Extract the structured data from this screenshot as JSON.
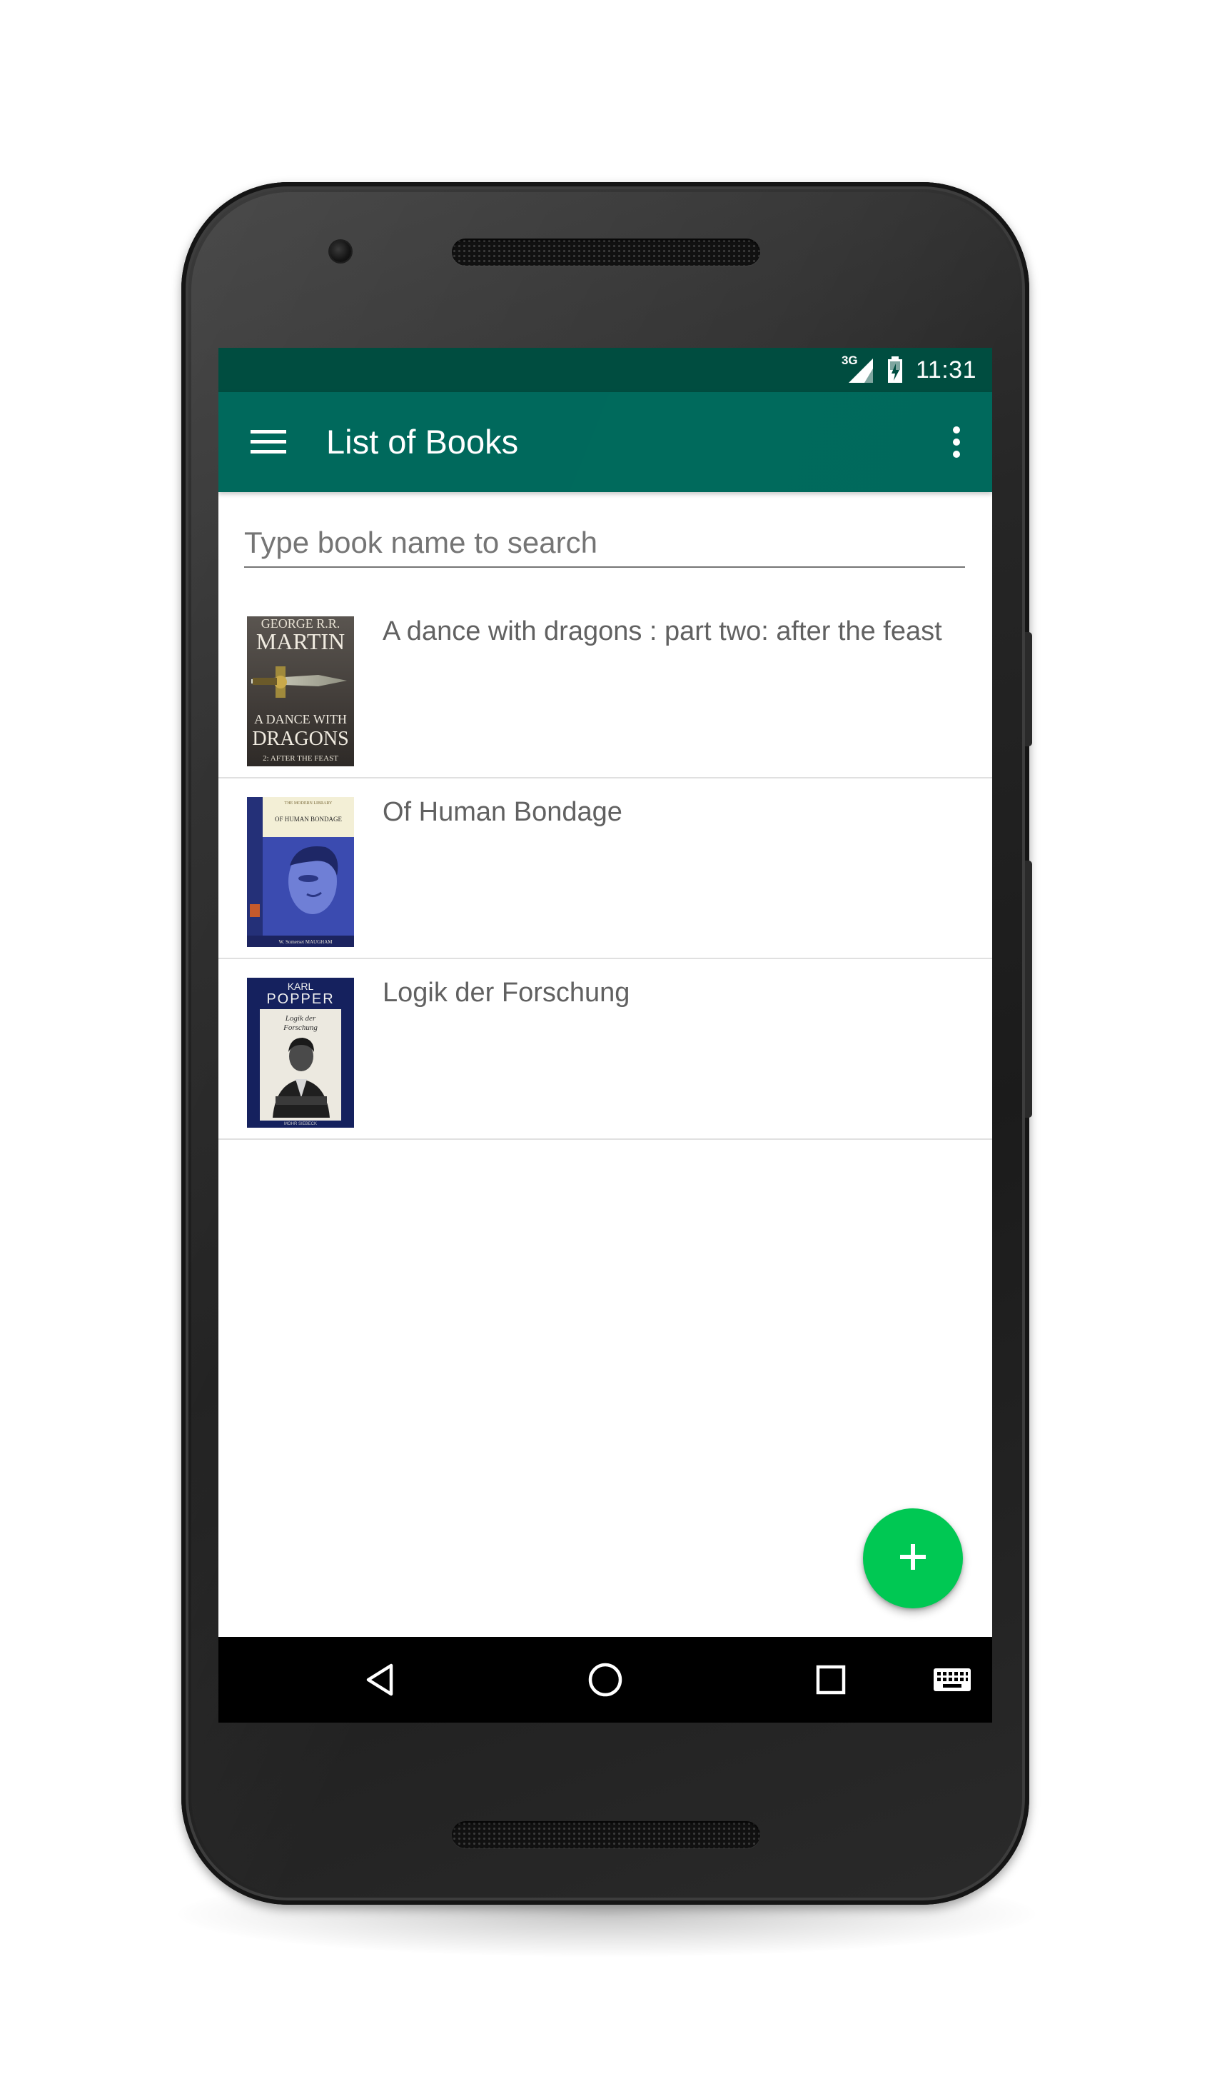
{
  "status_bar": {
    "network_type": "3G",
    "time": "11:31"
  },
  "toolbar": {
    "title": "List of Books",
    "menu_icon": "hamburger-menu-icon",
    "overflow_icon": "more-vert-icon"
  },
  "search": {
    "placeholder": "Type book name to search",
    "value": ""
  },
  "books": [
    {
      "title": "A dance with dragons : part two: after the feast",
      "cover": {
        "author_line1": "GEORGE R.R.",
        "author_line2": "MARTIN",
        "title_line1": "A DANCE WITH",
        "title_line2": "DRAGONS",
        "subtitle": "2: AFTER THE FEAST"
      }
    },
    {
      "title": "Of Human Bondage",
      "cover": {
        "series": "THE MODERN LIBRARY",
        "title": "OF HUMAN BONDAGE",
        "author": "W. Somerset MAUGHAM"
      }
    },
    {
      "title": "Logik der Forschung",
      "cover": {
        "author_line1": "KARL",
        "author_line2": "POPPER",
        "title_line1": "Logik der",
        "title_line2": "Forschung",
        "footer": "MOHR SIEBECK"
      }
    }
  ],
  "fab": {
    "icon": "plus-icon"
  },
  "nav_bar": {
    "icons": [
      "back-icon",
      "home-icon",
      "recents-icon",
      "keyboard-icon"
    ]
  },
  "colors": {
    "status_bar": "#004d40",
    "toolbar": "#00695c",
    "fab": "#00c853",
    "text": "#616161",
    "divider": "#e0e0e0"
  }
}
